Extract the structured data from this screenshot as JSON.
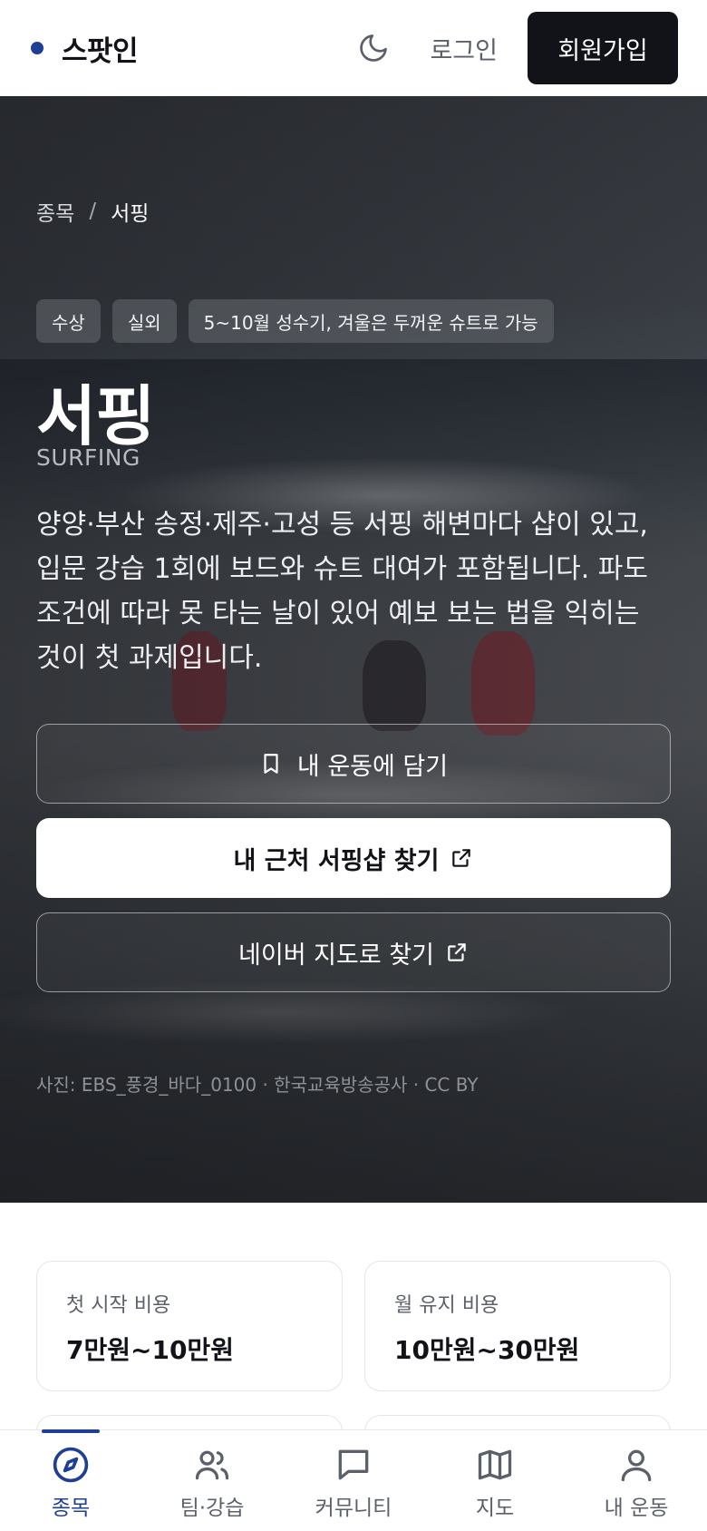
{
  "header": {
    "logo": "스팟인",
    "theme_icon": "moon-icon",
    "login": "로그인",
    "signup": "회원가입"
  },
  "hero": {
    "breadcrumb": [
      "종목",
      "/",
      "서핑"
    ],
    "tags": [
      "수상",
      "실외",
      "5~10월 성수기, 겨울은 두꺼운 슈트로 가능"
    ],
    "title": "서핑",
    "title_en": "SURFING",
    "description": "양양·부산 송정·제주·고성 등 서핑 해변마다 샵이 있고, 입문 강습 1회에 보드와 슈트 대여가 포함됩니다. 파도 조건에 따라 못 타는 날이 있어 예보 보는 법을 익히는 것이 첫 과제입니다.",
    "save_button": "내 운동에 담기",
    "find_shop_button": "내 근처 서핑샵 찾기",
    "naver_map_button": "네이버 지도로 찾기",
    "photo_credit": "사진: EBS_풍경_바다_0100 · 한국교육방송공사 · CC BY"
  },
  "costs": [
    {
      "label": "첫 시작 비용",
      "value": "7만원~10만원"
    },
    {
      "label": "월 유지 비용",
      "value": "10만원~30만원"
    }
  ],
  "bottom_nav": {
    "items": [
      {
        "label": "종목",
        "icon": "compass-icon",
        "active": true
      },
      {
        "label": "팀·강습",
        "icon": "users-icon",
        "active": false
      },
      {
        "label": "커뮤니티",
        "icon": "chat-icon",
        "active": false
      },
      {
        "label": "지도",
        "icon": "map-icon",
        "active": false
      },
      {
        "label": "내 운동",
        "icon": "user-icon",
        "active": false
      }
    ]
  },
  "colors": {
    "brand": "#1f3f96",
    "dark": "#111318"
  }
}
